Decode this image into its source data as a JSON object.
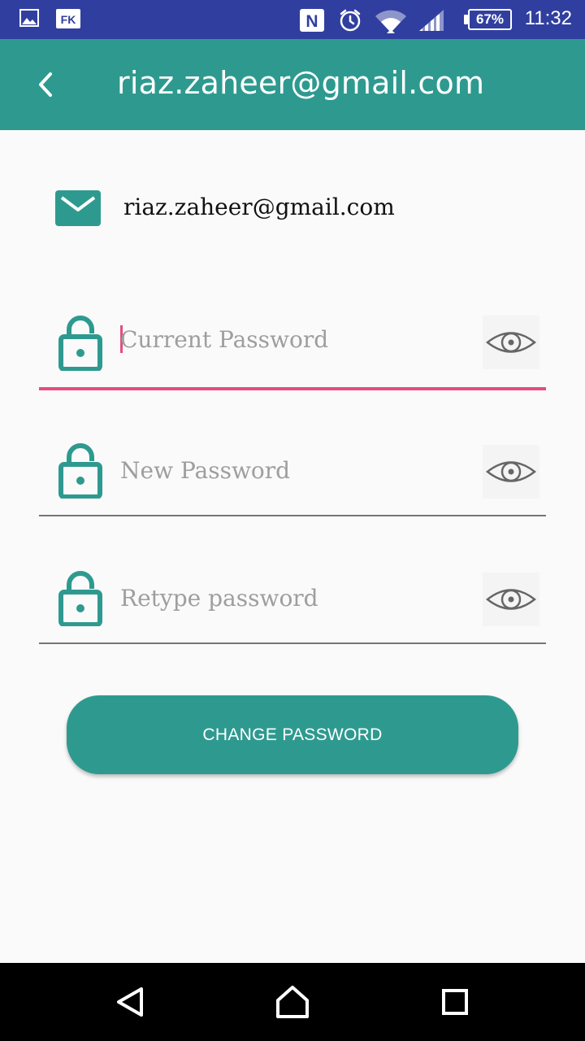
{
  "status_bar": {
    "time": "11:32",
    "battery": "67%",
    "icons": [
      "image-icon",
      "fk-icon",
      "nfc-icon",
      "alarm-icon",
      "wifi-icon",
      "signal-icon",
      "battery-icon"
    ],
    "fk_label": "FK",
    "nfc_label": "N"
  },
  "app_bar": {
    "title": "riaz.zaheer@gmail.com",
    "back_icon": "back-arrow-icon"
  },
  "account": {
    "email": "riaz.zaheer@gmail.com",
    "icon": "mail-icon"
  },
  "fields": [
    {
      "placeholder": "Current Password",
      "value": "",
      "lock_icon": "lock-icon",
      "eye_icon": "eye-icon",
      "focused": true
    },
    {
      "placeholder": "New Password",
      "value": "",
      "lock_icon": "lock-icon",
      "eye_icon": "eye-icon",
      "focused": false
    },
    {
      "placeholder": "Retype password",
      "value": "",
      "lock_icon": "lock-icon",
      "eye_icon": "eye-icon",
      "focused": false
    }
  ],
  "actions": {
    "change_password_label": "CHANGE PASSWORD"
  },
  "colors": {
    "status_bar": "#303f9f",
    "primary": "#2e9a8f",
    "accent": "#e74c7c",
    "background": "#fafafa",
    "nav_bar": "#000000"
  },
  "nav_bar": {
    "icons": [
      "nav-back-icon",
      "nav-home-icon",
      "nav-recents-icon"
    ]
  }
}
